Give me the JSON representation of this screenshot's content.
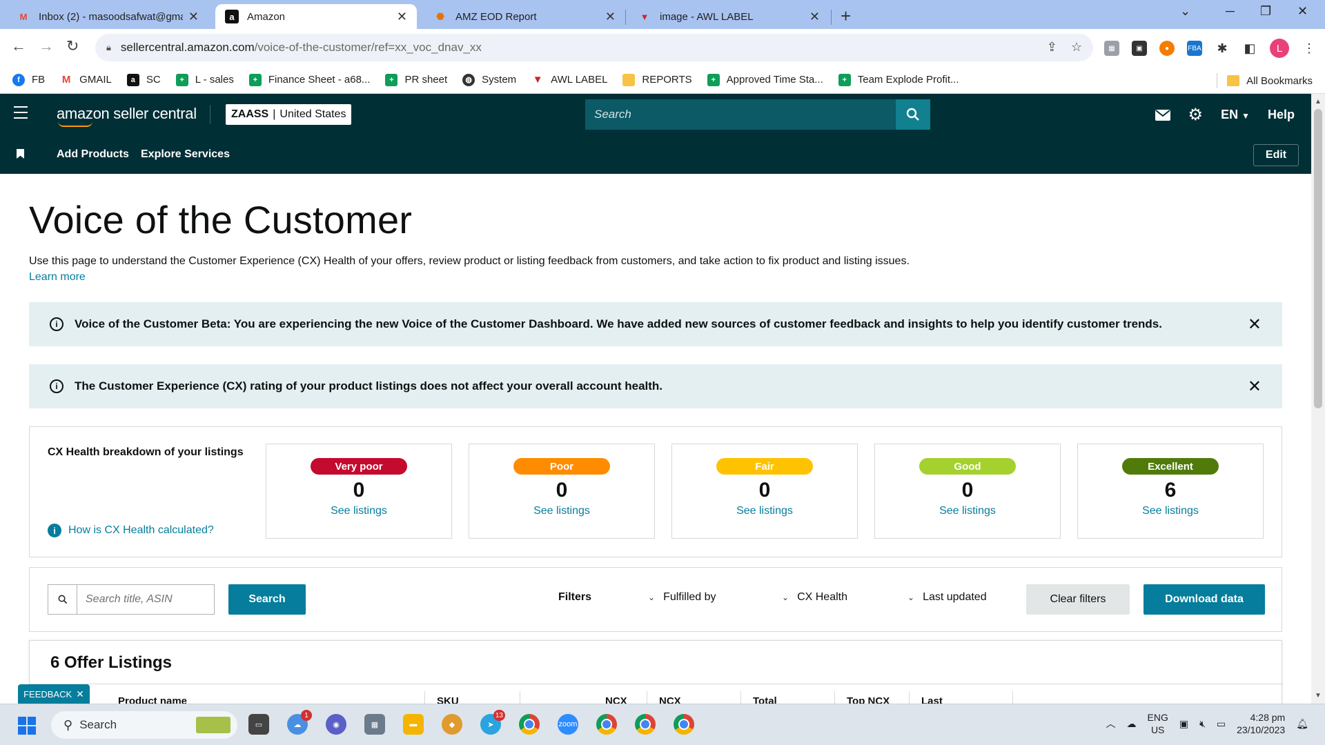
{
  "browser": {
    "tabs": [
      {
        "label": "Inbox (2) - masoodsafwat@gma",
        "icon": "gmail-icon",
        "active": false
      },
      {
        "label": "Amazon",
        "icon": "amazon-icon",
        "active": true
      },
      {
        "label": "AMZ EOD Report",
        "icon": "report-icon",
        "active": false
      },
      {
        "label": "image - AWL LABEL",
        "icon": "awl-icon",
        "active": false
      }
    ],
    "url_host": "sellercentral.amazon.com",
    "url_path": "/voice-of-the-customer/ref=xx_voc_dnav_xx",
    "profile_initial": "L",
    "bookmarks": [
      {
        "label": "FB",
        "color": "#1877f2"
      },
      {
        "label": "GMAIL",
        "color": "#ea4335"
      },
      {
        "label": "SC",
        "color": "#111111"
      },
      {
        "label": "L - sales",
        "color": "#0f9d58"
      },
      {
        "label": "Finance Sheet - a68...",
        "color": "#0f9d58"
      },
      {
        "label": "PR sheet",
        "color": "#0f9d58"
      },
      {
        "label": "System",
        "color": "#333333"
      },
      {
        "label": "AWL LABEL",
        "color": "#c62828"
      },
      {
        "label": "REPORTS",
        "color": "#f6c344"
      },
      {
        "label": "Approved Time Sta...",
        "color": "#0f9d58"
      },
      {
        "label": "Team Explode Profit...",
        "color": "#0f9d58"
      }
    ],
    "all_bookmarks": "All Bookmarks"
  },
  "header": {
    "logo_text": "amazon seller central",
    "store": "ZAASS",
    "marketplace": "United States",
    "search_placeholder": "Search",
    "language": "EN",
    "help": "Help"
  },
  "subnav": {
    "links": [
      "Add Products",
      "Explore Services"
    ],
    "edit": "Edit"
  },
  "page": {
    "title": "Voice of the Customer",
    "intro": "Use this page to understand the Customer Experience (CX) Health of your offers, review product or listing feedback from customers, and take action to fix product and listing issues.",
    "learn_more": "Learn more",
    "alert_beta": "Voice of the Customer Beta: You are experiencing the new Voice of the Customer Dashboard. We have added new sources of customer feedback and insights to help you identify customer trends.",
    "alert_cx": "The Customer Experience (CX) rating of your product listings does not affect your overall account health."
  },
  "cx_breakdown": {
    "title": "CX Health breakdown of your listings",
    "how_link": "How is CX Health calculated?",
    "cards": [
      {
        "label": "Very poor",
        "count": "0",
        "link": "See listings",
        "color": "#c40a2f"
      },
      {
        "label": "Poor",
        "count": "0",
        "link": "See listings",
        "color": "#ff8c00"
      },
      {
        "label": "Fair",
        "count": "0",
        "link": "See listings",
        "color": "#ffc200"
      },
      {
        "label": "Good",
        "count": "0",
        "link": "See listings",
        "color": "#a4d12d"
      },
      {
        "label": "Excellent",
        "count": "6",
        "link": "See listings",
        "color": "#507b0a"
      }
    ]
  },
  "filters": {
    "search_placeholder": "Search title, ASIN",
    "search_button": "Search",
    "label": "Filters",
    "dropdowns": [
      "Fulfilled by",
      "CX Health",
      "Last updated"
    ],
    "clear": "Clear filters",
    "download": "Download data"
  },
  "listings": {
    "title": "6 Offer Listings",
    "columns": [
      "Product name",
      "SKU",
      "NCX",
      "NCX",
      "Total",
      "Top NCX",
      "Last"
    ]
  },
  "feedback": "FEEDBACK",
  "taskbar": {
    "search": "Search",
    "lang": "ENG",
    "region": "US",
    "time": "4:28 pm",
    "date": "23/10/2023",
    "badges": {
      "weather": "1",
      "telegram": "13"
    }
  }
}
